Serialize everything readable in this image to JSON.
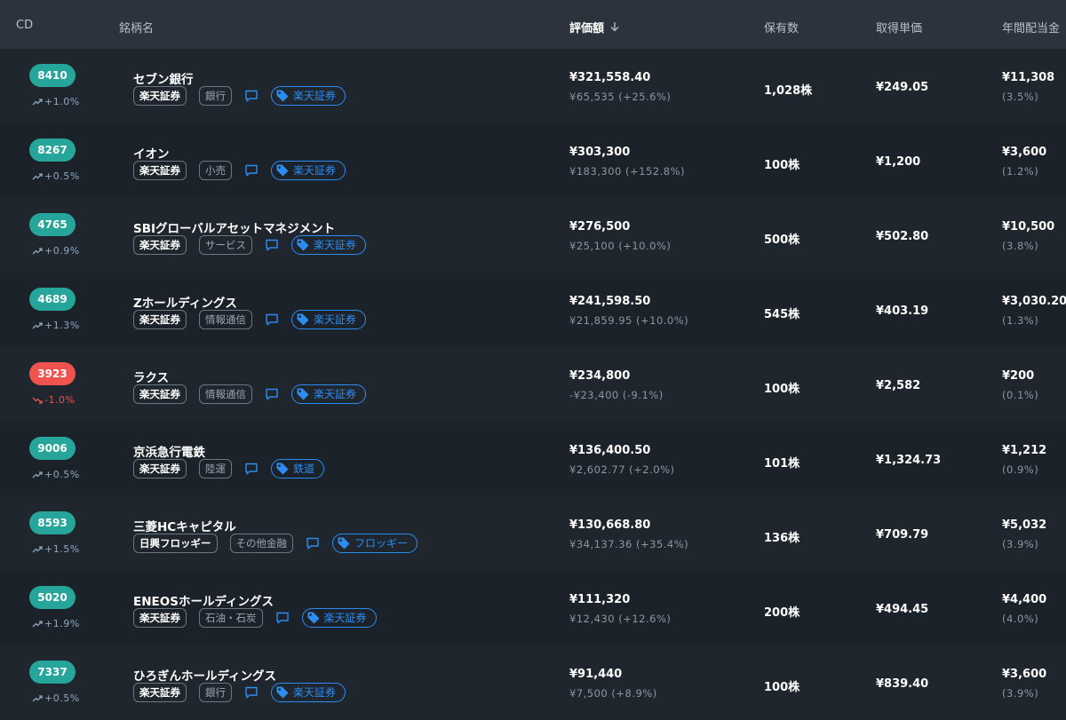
{
  "header": {
    "cd": "CD",
    "name": "銘柄名",
    "value": "評価額",
    "sort_icon": "arrow-down-icon",
    "qty": "保有数",
    "cost": "取得単価",
    "dividend": "年間配当金"
  },
  "colors": {
    "up": "#26a69a",
    "down": "#ef5350",
    "tag": "#2d8cf0"
  },
  "rows": [
    {
      "code": "8410",
      "direction": "up",
      "change": "+1.0%",
      "name": "セブン銀行",
      "broker": "楽天証券",
      "sector": "銀行",
      "label": "楽天証券",
      "value": "¥321,558.40",
      "gain": "¥65,535 (+25.6%)",
      "qty": "1,028株",
      "cost": "¥249.05",
      "dividend": "¥11,308",
      "yield": "(3.5%)"
    },
    {
      "code": "8267",
      "direction": "up",
      "change": "+0.5%",
      "name": "イオン",
      "broker": "楽天証券",
      "sector": "小売",
      "label": "楽天証券",
      "value": "¥303,300",
      "gain": "¥183,300 (+152.8%)",
      "qty": "100株",
      "cost": "¥1,200",
      "dividend": "¥3,600",
      "yield": "(1.2%)"
    },
    {
      "code": "4765",
      "direction": "up",
      "change": "+0.9%",
      "name": "SBIグローバルアセットマネジメント",
      "broker": "楽天証券",
      "sector": "サービス",
      "label": "楽天証券",
      "value": "¥276,500",
      "gain": "¥25,100 (+10.0%)",
      "qty": "500株",
      "cost": "¥502.80",
      "dividend": "¥10,500",
      "yield": "(3.8%)"
    },
    {
      "code": "4689",
      "direction": "up",
      "change": "+1.3%",
      "name": "Zホールディングス",
      "broker": "楽天証券",
      "sector": "情報通信",
      "label": "楽天証券",
      "value": "¥241,598.50",
      "gain": "¥21,859.95 (+10.0%)",
      "qty": "545株",
      "cost": "¥403.19",
      "dividend": "¥3,030.20",
      "yield": "(1.3%)"
    },
    {
      "code": "3923",
      "direction": "down",
      "change": "-1.0%",
      "name": "ラクス",
      "broker": "楽天証券",
      "sector": "情報通信",
      "label": "楽天証券",
      "value": "¥234,800",
      "gain": "-¥23,400 (-9.1%)",
      "qty": "100株",
      "cost": "¥2,582",
      "dividend": "¥200",
      "yield": "(0.1%)"
    },
    {
      "code": "9006",
      "direction": "up",
      "change": "+0.5%",
      "name": "京浜急行電鉄",
      "broker": "楽天証券",
      "sector": "陸運",
      "label": "鉄道",
      "value": "¥136,400.50",
      "gain": "¥2,602.77 (+2.0%)",
      "qty": "101株",
      "cost": "¥1,324.73",
      "dividend": "¥1,212",
      "yield": "(0.9%)"
    },
    {
      "code": "8593",
      "direction": "up",
      "change": "+1.5%",
      "name": "三菱HCキャピタル",
      "broker": "日興フロッギー",
      "sector": "その他金融",
      "label": "フロッギー",
      "value": "¥130,668.80",
      "gain": "¥34,137.36 (+35.4%)",
      "qty": "136株",
      "cost": "¥709.79",
      "dividend": "¥5,032",
      "yield": "(3.9%)"
    },
    {
      "code": "5020",
      "direction": "up",
      "change": "+1.9%",
      "name": "ENEOSホールディングス",
      "broker": "楽天証券",
      "sector": "石油・石炭",
      "label": "楽天証券",
      "value": "¥111,320",
      "gain": "¥12,430 (+12.6%)",
      "qty": "200株",
      "cost": "¥494.45",
      "dividend": "¥4,400",
      "yield": "(4.0%)"
    },
    {
      "code": "7337",
      "direction": "up",
      "change": "+0.5%",
      "name": "ひろぎんホールディングス",
      "broker": "楽天証券",
      "sector": "銀行",
      "label": "楽天証券",
      "value": "¥91,440",
      "gain": "¥7,500 (+8.9%)",
      "qty": "100株",
      "cost": "¥839.40",
      "dividend": "¥3,600",
      "yield": "(3.9%)"
    }
  ]
}
